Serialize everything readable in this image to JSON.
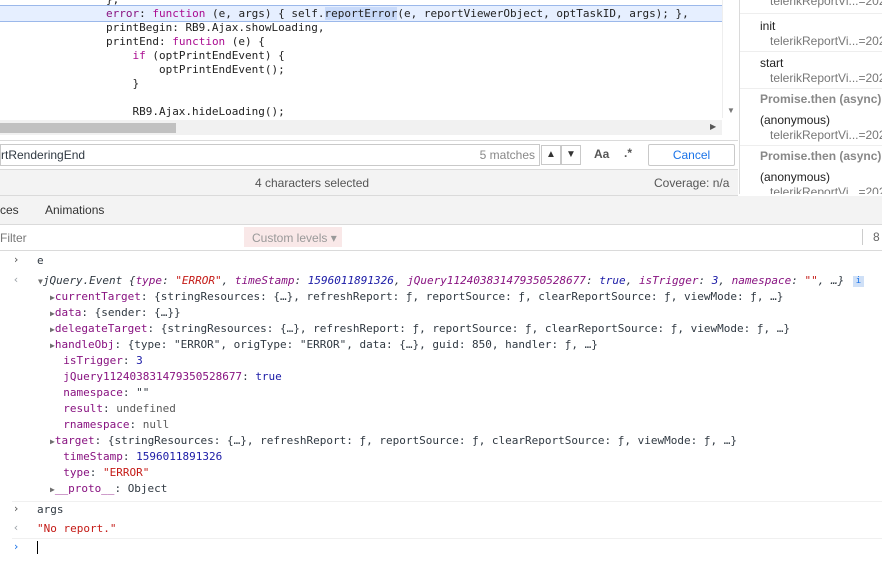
{
  "code": {
    "lines": [
      {
        "pre": "                ",
        "rest": "},"
      },
      {
        "pre": "                ",
        "kw_label": "error",
        "rest_a": ": ",
        "kw": "function",
        "rest_b": " (e, args) { self.",
        "selected": "reportError",
        "rest_c": "(e, reportViewerObject, optTaskID, args); },"
      },
      {
        "text": "                printBegin: RB9.Ajax.showLoading,"
      },
      {
        "text": "                printEnd: function (e) {"
      },
      {
        "text": "                    if (optPrintEndEvent) {"
      },
      {
        "text": "                        optPrintEndEvent();"
      },
      {
        "text": "                    }"
      },
      {
        "text": ""
      },
      {
        "text": "                    RB9.Ajax.hideLoading();"
      }
    ]
  },
  "search": {
    "query": "rtRenderingEnd",
    "matches": "5 matches",
    "prev_icon": "chevron-up-icon",
    "next_icon": "chevron-down-icon",
    "case_label": "Aa",
    "regex_label": ".*",
    "cancel_label": "Cancel"
  },
  "status": {
    "selection": "4 characters selected",
    "coverage": "Coverage: n/a"
  },
  "callstack": {
    "items": [
      {
        "type": "loc",
        "loc": "telerikReportVi...=202"
      },
      {
        "type": "frame",
        "name": "init",
        "loc": "telerikReportVi...=202"
      },
      {
        "type": "frame",
        "name": "start",
        "loc": "telerikReportVi...=202"
      },
      {
        "type": "async",
        "label": "Promise.then (async)"
      },
      {
        "type": "frame",
        "name": "(anonymous)",
        "loc": "telerikReportVi...=202"
      },
      {
        "type": "async",
        "label": "Promise.then (async)"
      },
      {
        "type": "frame",
        "name": "(anonymous)",
        "loc": "telerikReportVi...=202"
      }
    ]
  },
  "drawer": {
    "tabs": [
      "ces",
      "Animations"
    ]
  },
  "console_toolbar": {
    "filter_placeholder": "Filter",
    "levels_label": "Custom levels ▾",
    "hidden_count": "8"
  },
  "console": {
    "input1": "e",
    "event_summary": {
      "label": "jQuery.Event",
      "type_val": "\"ERROR\"",
      "ts_val": "1596011891326",
      "jq_key": "jQuery112403831479350528677",
      "jq_val": "true",
      "trig_val": "3",
      "ns_val": "\"\""
    },
    "props": [
      {
        "expandable": true,
        "key": "currentTarget",
        "val": "{stringResources: {…}, refreshReport: ƒ, reportSource: ƒ, clearReportSource: ƒ, viewMode: ƒ, …}"
      },
      {
        "expandable": true,
        "key": "data",
        "val": "{sender: {…}}"
      },
      {
        "expandable": true,
        "key": "delegateTarget",
        "val": "{stringResources: {…}, refreshReport: ƒ, reportSource: ƒ, clearReportSource: ƒ, viewMode: ƒ, …}"
      },
      {
        "expandable": true,
        "key": "handleObj",
        "val": "{type: \"ERROR\", origType: \"ERROR\", data: {…}, guid: 850, handler: ƒ, …}"
      },
      {
        "expandable": false,
        "key": "isTrigger",
        "val": "3",
        "kind": "n"
      },
      {
        "expandable": false,
        "key": "jQuery112403831479350528677",
        "val": "true",
        "kind": "b"
      },
      {
        "expandable": false,
        "key": "namespace",
        "val": "\"\"",
        "kind": "plain"
      },
      {
        "expandable": false,
        "key": "result",
        "val": "undefined",
        "kind": "g"
      },
      {
        "expandable": false,
        "key": "rnamespace",
        "val": "null",
        "kind": "g"
      },
      {
        "expandable": true,
        "key": "target",
        "val": "{stringResources: {…}, refreshReport: ƒ, reportSource: ƒ, clearReportSource: ƒ, viewMode: ƒ, …}"
      },
      {
        "expandable": false,
        "key": "timeStamp",
        "val": "1596011891326",
        "kind": "n"
      },
      {
        "expandable": false,
        "key": "type",
        "val": "\"ERROR\"",
        "kind": "s"
      },
      {
        "expandable": true,
        "key": "__proto__",
        "val": "Object",
        "kind": "plain"
      }
    ],
    "input2": "args",
    "output2": "\"No report.\""
  }
}
